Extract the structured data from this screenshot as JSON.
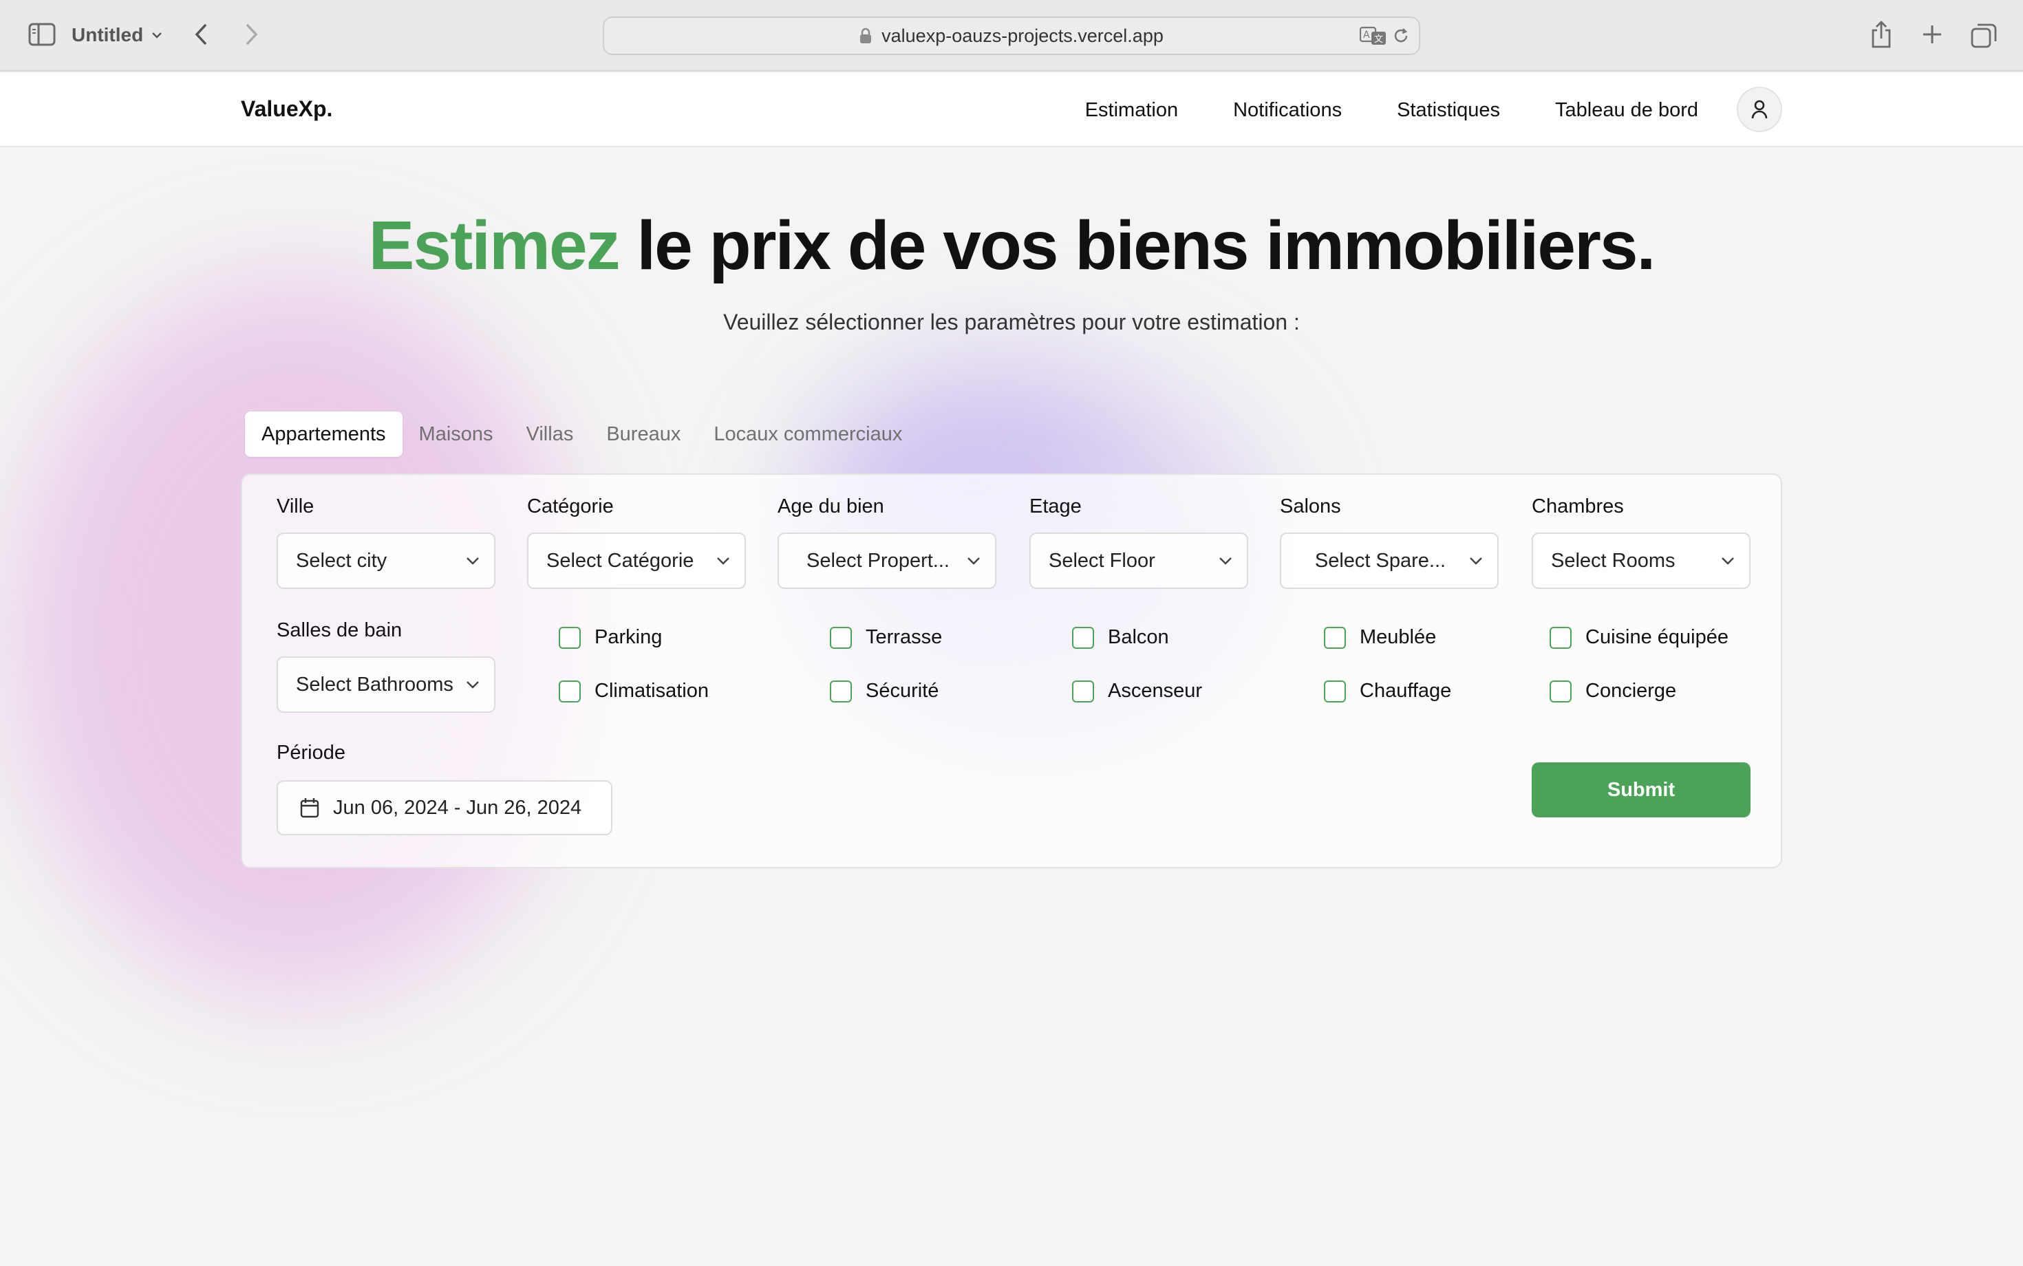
{
  "browser": {
    "tab_title": "Untitled",
    "url": "valuexp-oauzs-projects.vercel.app"
  },
  "nav": {
    "brand": "ValueXp.",
    "links": [
      "Estimation",
      "Notifications",
      "Statistiques",
      "Tableau de bord"
    ]
  },
  "hero": {
    "accent": "Estimez",
    "title_rest": " le prix de vos biens immobiliers.",
    "subtitle": "Veuillez sélectionner les paramètres pour votre estimation :"
  },
  "tabs": [
    "Appartements",
    "Maisons",
    "Villas",
    "Bureaux",
    "Locaux commerciaux"
  ],
  "form": {
    "fields": [
      {
        "label": "Ville",
        "value": "Select city"
      },
      {
        "label": "Catégorie",
        "value": "Select Catégorie"
      },
      {
        "label": "Age du bien",
        "value": "Select Propert..."
      },
      {
        "label": "Etage",
        "value": "Select Floor"
      },
      {
        "label": "Salons",
        "value": "Select Spare..."
      },
      {
        "label": "Chambres",
        "value": "Select Rooms"
      },
      {
        "label": "Salles de bain",
        "value": "Select Bathrooms"
      }
    ],
    "checkboxes": [
      "Parking",
      "Terrasse",
      "Balcon",
      "Meublée",
      "Cuisine équipée",
      "Climatisation",
      "Sécurité",
      "Ascenseur",
      "Chauffage",
      "Concierge"
    ],
    "period_label": "Période",
    "period_value": "Jun 06, 2024 - Jun 26, 2024",
    "submit_label": "Submit"
  },
  "colors": {
    "accent_green": "#4aa356",
    "text": "#111111"
  }
}
